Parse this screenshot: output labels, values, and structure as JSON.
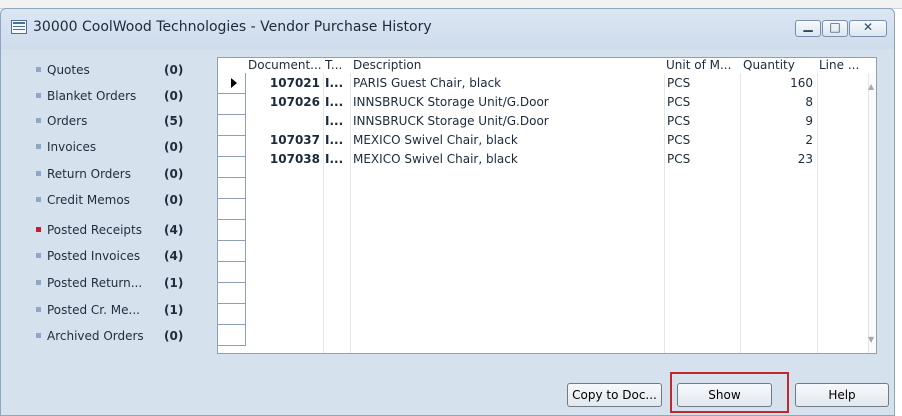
{
  "window": {
    "title": "30000 CoolWood Technologies - Vendor Purchase History"
  },
  "nav": [
    {
      "label": "Quotes",
      "count": "(0)",
      "bullet": "#8fa8c9"
    },
    {
      "label": "Blanket Orders",
      "count": "(0)",
      "bullet": "#8fa8c9"
    },
    {
      "label": "Orders",
      "count": "(5)",
      "bullet": "#8fa8c9"
    },
    {
      "label": "Invoices",
      "count": "(0)",
      "bullet": "#8fa8c9"
    },
    {
      "label": "Return Orders",
      "count": "(0)",
      "bullet": "#8fa8c9"
    },
    {
      "label": "Credit Memos",
      "count": "(0)",
      "bullet": "#8fa8c9"
    },
    {
      "label": "Posted Receipts",
      "count": "(4)",
      "bullet": "#d3162b"
    },
    {
      "label": "Posted Invoices",
      "count": "(4)",
      "bullet": "#8fa8c9"
    },
    {
      "label": "Posted Return...",
      "count": "(1)",
      "bullet": "#8fa8c9"
    },
    {
      "label": "Posted Cr. Me...",
      "count": "(1)",
      "bullet": "#8fa8c9"
    },
    {
      "label": "Archived Orders",
      "count": "(0)",
      "bullet": "#8fa8c9"
    }
  ],
  "table": {
    "columns": [
      "Document...",
      "T...",
      "Description",
      "Unit of M...",
      "Quantity",
      "Line ..."
    ],
    "rows": [
      {
        "document": "107021",
        "type": "I...",
        "description": "PARIS Guest Chair, black",
        "unit": "PCS",
        "quantity": "160",
        "line": ""
      },
      {
        "document": "107026",
        "type": "I...",
        "description": "INNSBRUCK Storage Unit/G.Door",
        "unit": "PCS",
        "quantity": "8",
        "line": ""
      },
      {
        "document": "",
        "type": "I...",
        "description": "INNSBRUCK Storage Unit/G.Door",
        "unit": "PCS",
        "quantity": "9",
        "line": ""
      },
      {
        "document": "107037",
        "type": "I...",
        "description": "MEXICO Swivel Chair, black",
        "unit": "PCS",
        "quantity": "2",
        "line": ""
      },
      {
        "document": "107038",
        "type": "I...",
        "description": "MEXICO Swivel Chair, black",
        "unit": "PCS",
        "quantity": "23",
        "line": ""
      }
    ]
  },
  "buttons": {
    "copy": "Copy to Doc...",
    "show": "Show",
    "help": "Help"
  },
  "highlight_color": "#c1272d"
}
